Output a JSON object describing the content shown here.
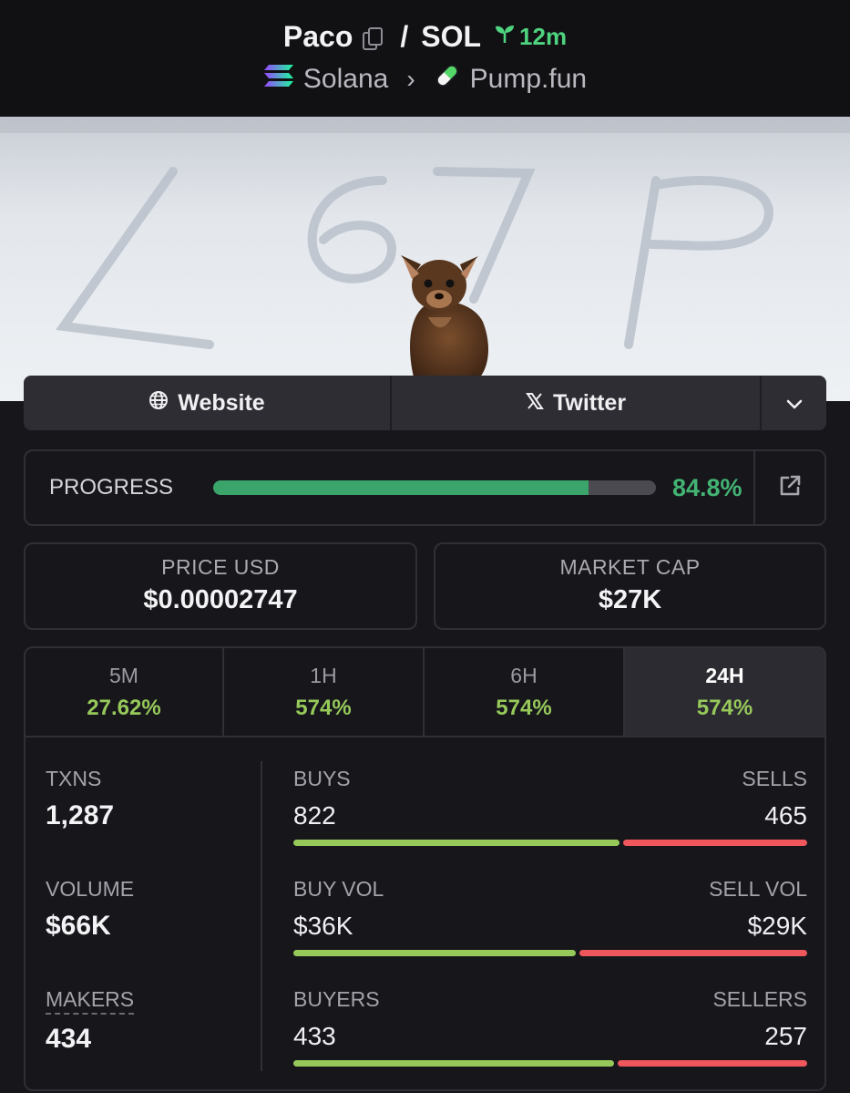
{
  "header": {
    "token": "Paco",
    "separator": "/",
    "quote": "SOL",
    "age": "12m",
    "chain": "Solana",
    "platform": "Pump.fun"
  },
  "links": {
    "website": "Website",
    "twitter": "Twitter"
  },
  "progress": {
    "label": "PROGRESS",
    "value_text": "84.8%",
    "fraction": 0.848
  },
  "price": {
    "label": "PRICE USD",
    "value": "$0.00002747"
  },
  "market_cap": {
    "label": "MARKET CAP",
    "value": "$27K"
  },
  "timeframes": [
    {
      "name": "5M",
      "change": "27.62%"
    },
    {
      "name": "1H",
      "change": "574%"
    },
    {
      "name": "6H",
      "change": "574%"
    },
    {
      "name": "24H",
      "change": "574%",
      "active": true
    }
  ],
  "stats": {
    "txns": {
      "label": "TXNS",
      "value": "1,287"
    },
    "volume": {
      "label": "VOLUME",
      "value": "$66K"
    },
    "makers": {
      "label": "MAKERS",
      "value": "434"
    },
    "buys": {
      "label": "BUYS",
      "value": "822",
      "ratio": 0.639
    },
    "sells": {
      "label": "SELLS",
      "value": "465"
    },
    "buy_vol": {
      "label": "BUY VOL",
      "value": "$36K",
      "ratio": 0.554
    },
    "sell_vol": {
      "label": "SELL VOL",
      "value": "$29K"
    },
    "buyers": {
      "label": "BUYERS",
      "value": "433",
      "ratio": 0.628
    },
    "sellers": {
      "label": "SELLERS",
      "value": "257"
    }
  },
  "colors": {
    "positive": "#97c95a",
    "negative": "#f0575c",
    "progress": "#3aa46a",
    "age": "#4ed37f"
  },
  "icons": [
    "copy-icon",
    "sprout-icon",
    "solana-logo-icon",
    "pill-icon",
    "globe-icon",
    "x-logo-icon",
    "chevron-down-icon",
    "external-link-icon"
  ]
}
